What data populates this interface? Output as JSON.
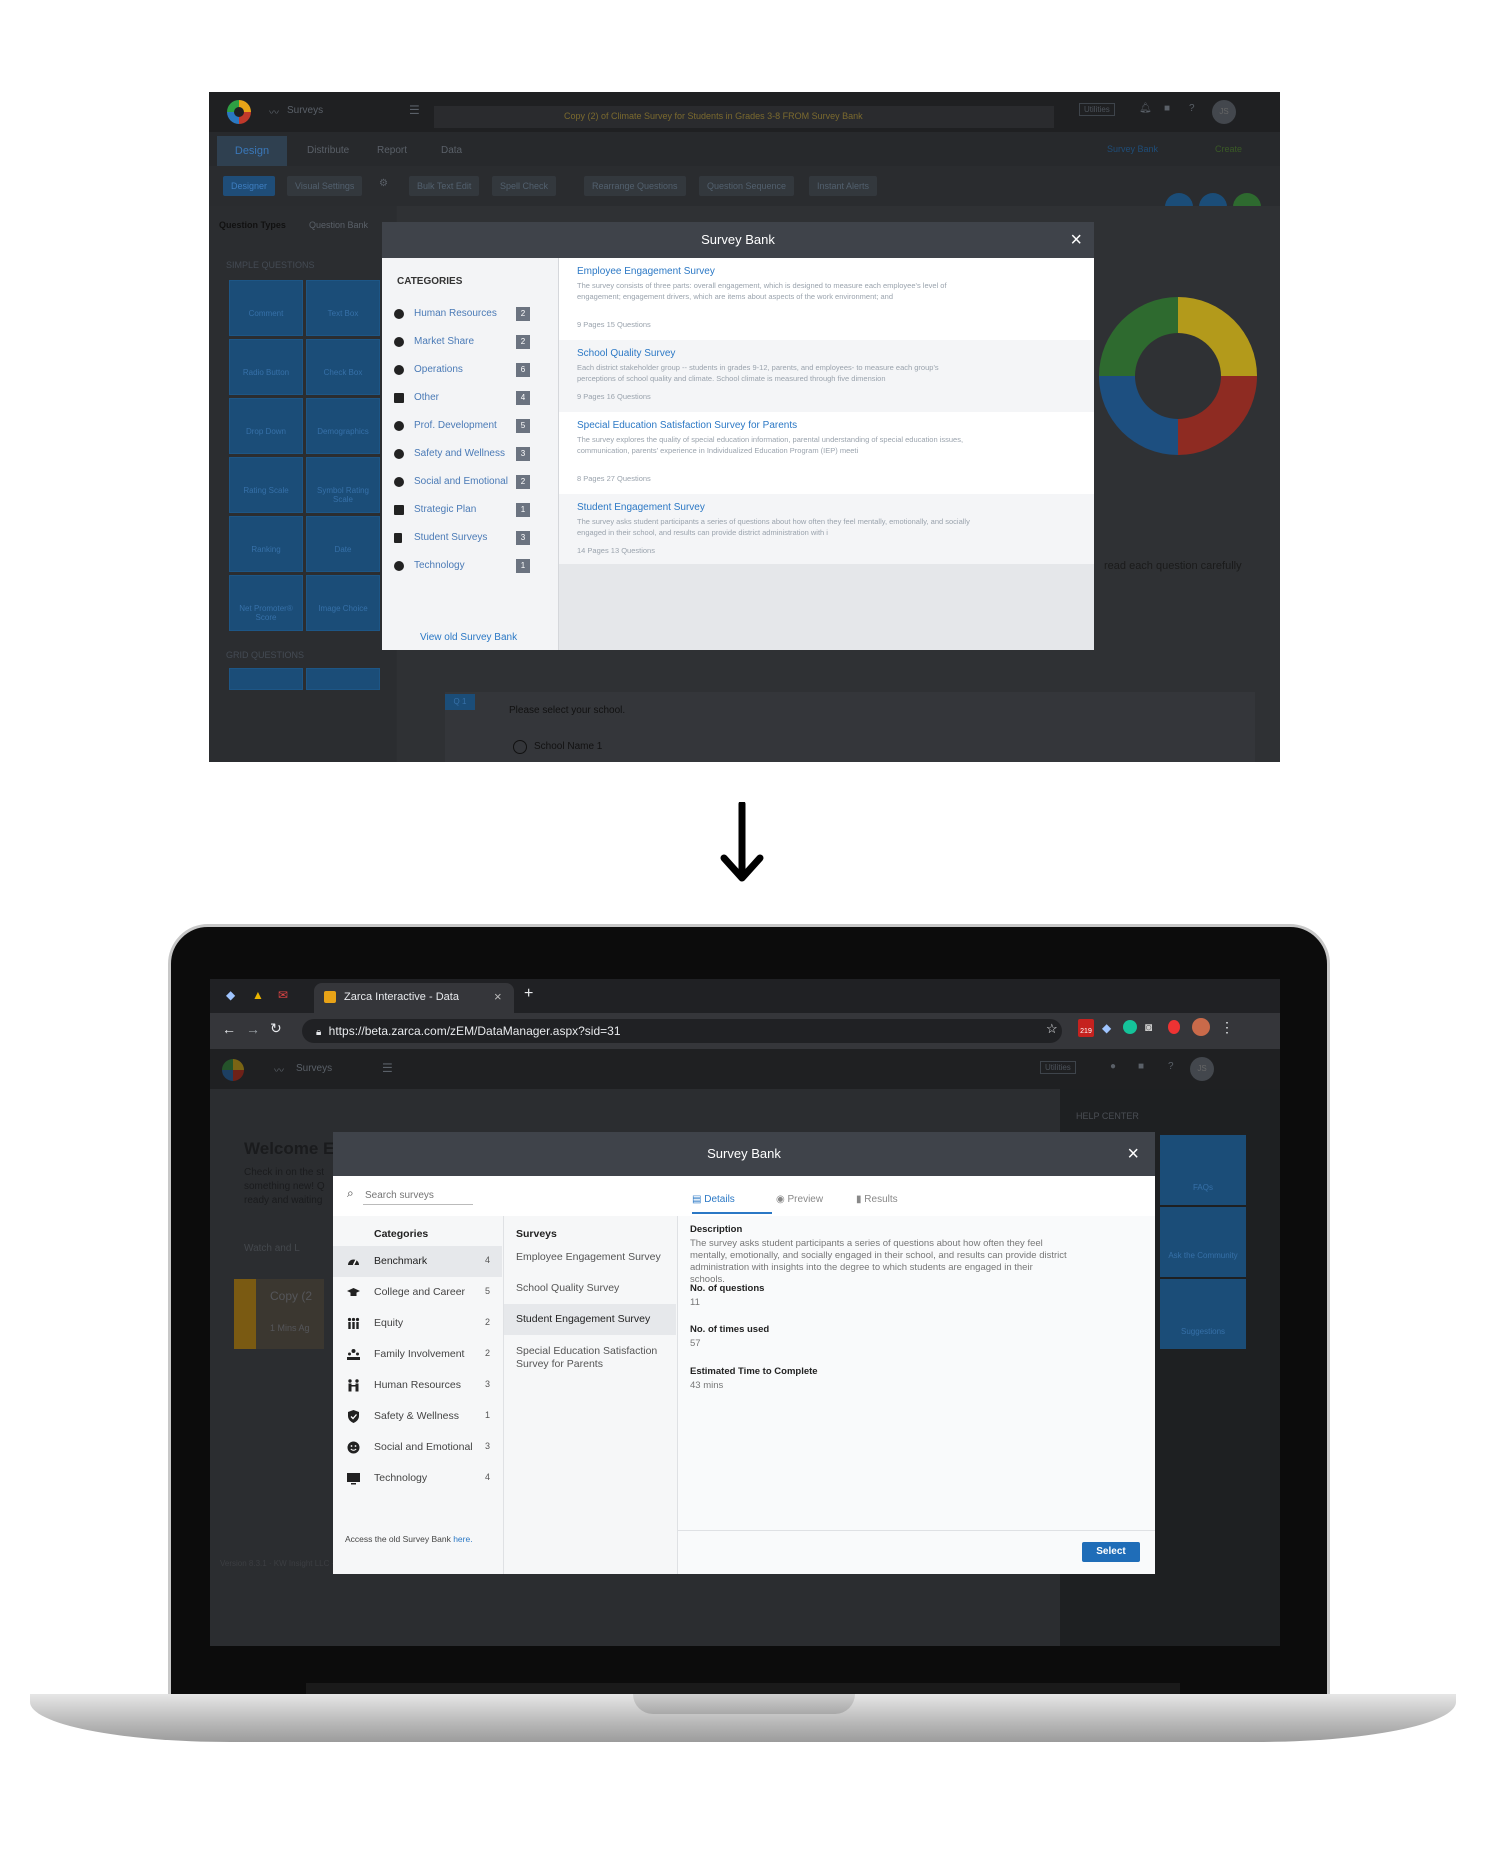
{
  "top_screenshot": {
    "app_nav": {
      "section": "Surveys",
      "utilities": "Utilities",
      "avatar": "JS"
    },
    "survey_title": "Copy (2) of Climate Survey for Students in Grades 3-8 FROM Survey Bank",
    "tabs": [
      "Design",
      "Distribute",
      "Report",
      "Data"
    ],
    "right_links": {
      "survey_bank": "Survey Bank",
      "create": "Create"
    },
    "toolbar": [
      "Designer",
      "Visual Settings",
      "Bulk Text Edit",
      "Spell Check",
      "Rearrange Questions",
      "Question Sequence",
      "Instant Alerts"
    ],
    "sidebar": {
      "tabs": [
        "Question Types",
        "Question Bank"
      ],
      "simple_heading": "SIMPLE QUESTIONS",
      "grid_heading": "GRID QUESTIONS",
      "tiles": [
        "Comment",
        "Text Box",
        "Radio Button",
        "Check Box",
        "Drop Down",
        "Demographics",
        "Rating Scale",
        "Symbol Rating Scale",
        "Ranking",
        "Date",
        "Net Promoter® Score",
        "Image Choice"
      ]
    },
    "instructions_text": "read each question carefully",
    "question": {
      "number": "Q 1",
      "text": "Please select your school.",
      "option1": "School Name 1"
    },
    "modal": {
      "title": "Survey Bank",
      "close": "×",
      "categories_heading": "CATEGORIES",
      "categories": [
        {
          "label": "Human Resources",
          "count": "2"
        },
        {
          "label": "Market Share",
          "count": "2"
        },
        {
          "label": "Operations",
          "count": "6"
        },
        {
          "label": "Other",
          "count": "4"
        },
        {
          "label": "Prof. Development",
          "count": "5"
        },
        {
          "label": "Safety and Wellness",
          "count": "3"
        },
        {
          "label": "Social and Emotional",
          "count": "2"
        },
        {
          "label": "Strategic Plan",
          "count": "1"
        },
        {
          "label": "Student Surveys",
          "count": "3"
        },
        {
          "label": "Technology",
          "count": "1"
        }
      ],
      "old_link": "View old Survey Bank",
      "surveys": [
        {
          "title": "Employee Engagement Survey",
          "desc": "The survey consists of three parts: overall engagement, which is designed to measure each employee's level of engagement; engagement drivers, which are items about aspects of the work environment; and",
          "meta": "9 Pages 15 Questions"
        },
        {
          "title": "School Quality Survey",
          "desc": "Each district stakeholder group -- students in grades 9-12, parents, and employees- to measure each group's perceptions of school quality and climate. School climate is measured through five dimension",
          "meta": "9 Pages 16 Questions"
        },
        {
          "title": "Special Education Satisfaction Survey for Parents",
          "desc": "The survey explores the quality of special education information, parental understanding of special education issues, communication, parents' experience in Individualized Education Program (IEP) meeti",
          "meta": "8 Pages 27 Questions"
        },
        {
          "title": "Student Engagement Survey",
          "desc": "The survey asks student participants a series of questions about how often they feel mentally, emotionally, and socially engaged in their school, and results can provide district administration with i",
          "meta": "14 Pages 13 Questions"
        }
      ]
    }
  },
  "browser": {
    "tab_title": "Zarca Interactive - Data",
    "url": "https://beta.zarca.com/zEM/DataManager.aspx?sid=31",
    "new_tab": "+",
    "badge": "219"
  },
  "bottom_app": {
    "nav_section": "Surveys",
    "utilities": "Utilities",
    "avatar": "JS",
    "welcome": "Welcome E",
    "welcome_body": [
      "Check in on the st",
      "something new! Q",
      "ready and waiting"
    ],
    "watch": "Watch and L",
    "card_title": "Copy (2",
    "card_time": "1 Mins Ag",
    "help_center": "HELP CENTER",
    "help_tiles": [
      "FAQs",
      "Ask the Community",
      "Suggestions"
    ],
    "footer": "Version 8.3.1 · KW Insight LLC · All rights reserved"
  },
  "bottom_modal": {
    "title": "Survey Bank",
    "close": "×",
    "search_placeholder": "Search surveys",
    "categories_heading": "Categories",
    "surveys_heading": "Surveys",
    "categories": [
      {
        "label": "Benchmark",
        "count": "4",
        "icon": "gauge-icon"
      },
      {
        "label": "College and Career",
        "count": "5",
        "icon": "graduation-cap-icon"
      },
      {
        "label": "Equity",
        "count": "2",
        "icon": "people-equity-icon"
      },
      {
        "label": "Family Involvement",
        "count": "2",
        "icon": "family-icon"
      },
      {
        "label": "Human Resources",
        "count": "3",
        "icon": "people-icon"
      },
      {
        "label": "Safety & Wellness",
        "count": "1",
        "icon": "shield-icon"
      },
      {
        "label": "Social and Emotional",
        "count": "3",
        "icon": "smiley-icon"
      },
      {
        "label": "Technology",
        "count": "4",
        "icon": "monitor-icon"
      }
    ],
    "surveys": [
      "Employee Engagement Survey",
      "School Quality Survey",
      "Student Engagement Survey",
      "Special Education Satisfaction Survey for Parents"
    ],
    "access_text": "Access the old Survey Bank ",
    "access_link": "here.",
    "detail_tabs": [
      "Details",
      "Preview",
      "Results"
    ],
    "details": {
      "description_label": "Description",
      "description": "The survey asks student participants a series of questions about how often they feel mentally, emotionally, and socially engaged in their school, and results can provide district administration with insights into the degree to which students are engaged in their schools.",
      "questions_label": "No. of questions",
      "questions": "11",
      "used_label": "No. of times used",
      "used": "57",
      "time_label": "Estimated Time to Complete",
      "time": "43 mins"
    },
    "select_label": "Select"
  },
  "colors": {
    "accent": "#2b78c5",
    "select_button": "#1f6db8",
    "header": "#3f434a"
  }
}
